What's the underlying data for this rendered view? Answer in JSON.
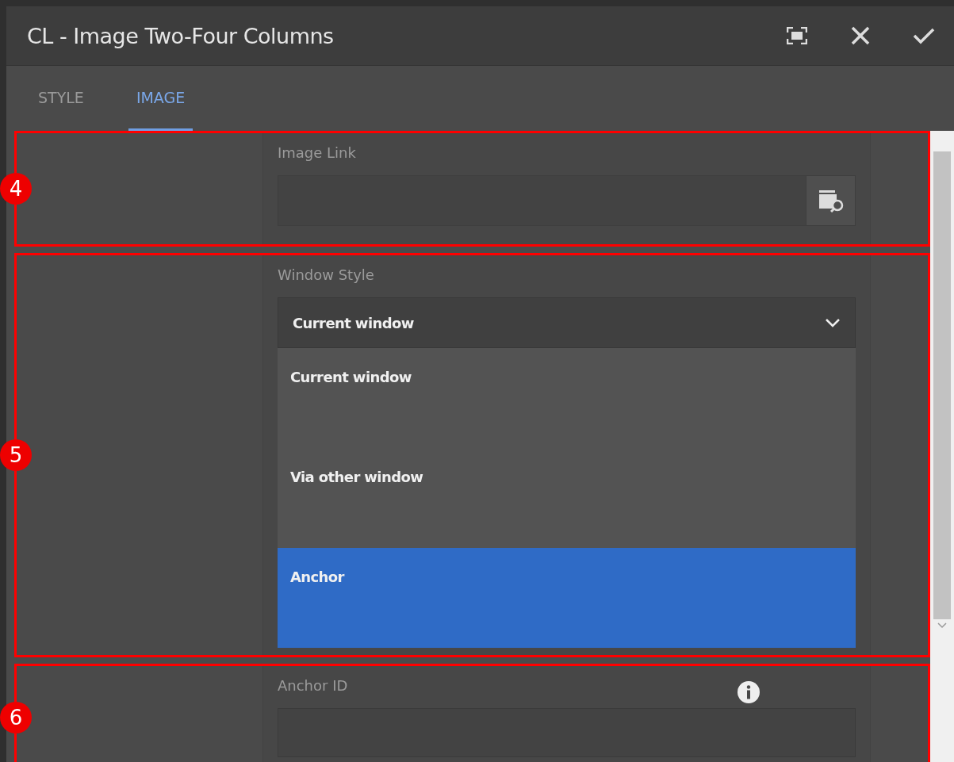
{
  "window": {
    "title": "CL - Image Two-Four Columns"
  },
  "tabs": [
    {
      "label": "STYLE",
      "selected": false
    },
    {
      "label": "IMAGE",
      "selected": true
    }
  ],
  "sections": [
    {
      "number": "4",
      "field": {
        "kind": "path",
        "label": "Image Link"
      }
    },
    {
      "number": "5",
      "field": {
        "kind": "select",
        "label": "Window Style",
        "value": "Current window",
        "expanded": true,
        "options": [
          {
            "label": "Current window",
            "highlighted": false
          },
          {
            "label": "Via other window",
            "highlighted": false
          },
          {
            "label": "Anchor",
            "highlighted": true
          }
        ]
      }
    },
    {
      "number": "6",
      "field": {
        "kind": "text",
        "label": "Anchor ID",
        "info": true
      }
    }
  ]
}
